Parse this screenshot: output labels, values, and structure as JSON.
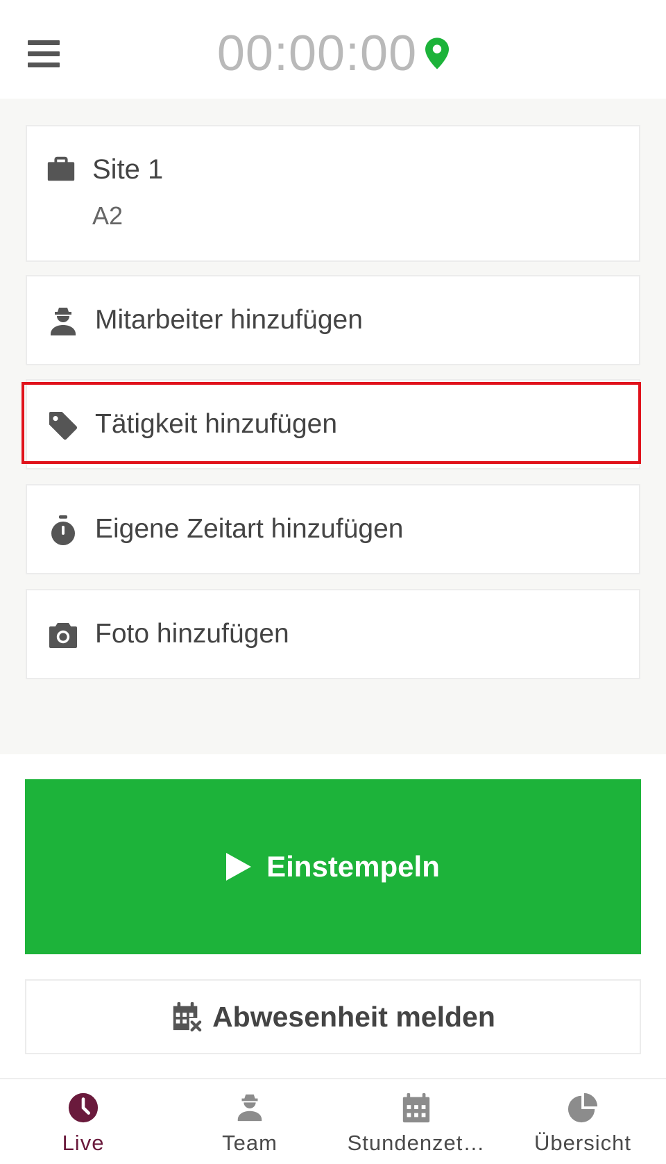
{
  "header": {
    "timer": "00:00:00",
    "location_icon": "map-pin-icon",
    "location_color": "#1db33a"
  },
  "site": {
    "title": "Site 1",
    "subtitle": "A2",
    "icon": "briefcase-icon"
  },
  "actions": [
    {
      "label": "Mitarbeiter hinzufügen",
      "icon": "worker-icon"
    },
    {
      "label": "Tätigkeit hinzufügen",
      "icon": "tag-icon"
    },
    {
      "label": "Eigene Zeitart hinzufügen",
      "icon": "stopwatch-icon"
    },
    {
      "label": "Foto hinzufügen",
      "icon": "camera-icon"
    }
  ],
  "clock_in": {
    "label": "Einstempeln",
    "color": "#1db33a"
  },
  "absence": {
    "label": "Abwesenheit melden",
    "icon": "calendar-cancel-icon"
  },
  "tabs": [
    {
      "label": "Live",
      "icon": "clock-icon",
      "active": true
    },
    {
      "label": "Team",
      "icon": "worker-icon",
      "active": false
    },
    {
      "label": "Stundenzet…",
      "icon": "calendar-icon",
      "active": false
    },
    {
      "label": "Übersicht",
      "icon": "pie-chart-icon",
      "active": false
    }
  ],
  "colors": {
    "accent": "#6a1a3c",
    "highlight": "#e0121b"
  }
}
